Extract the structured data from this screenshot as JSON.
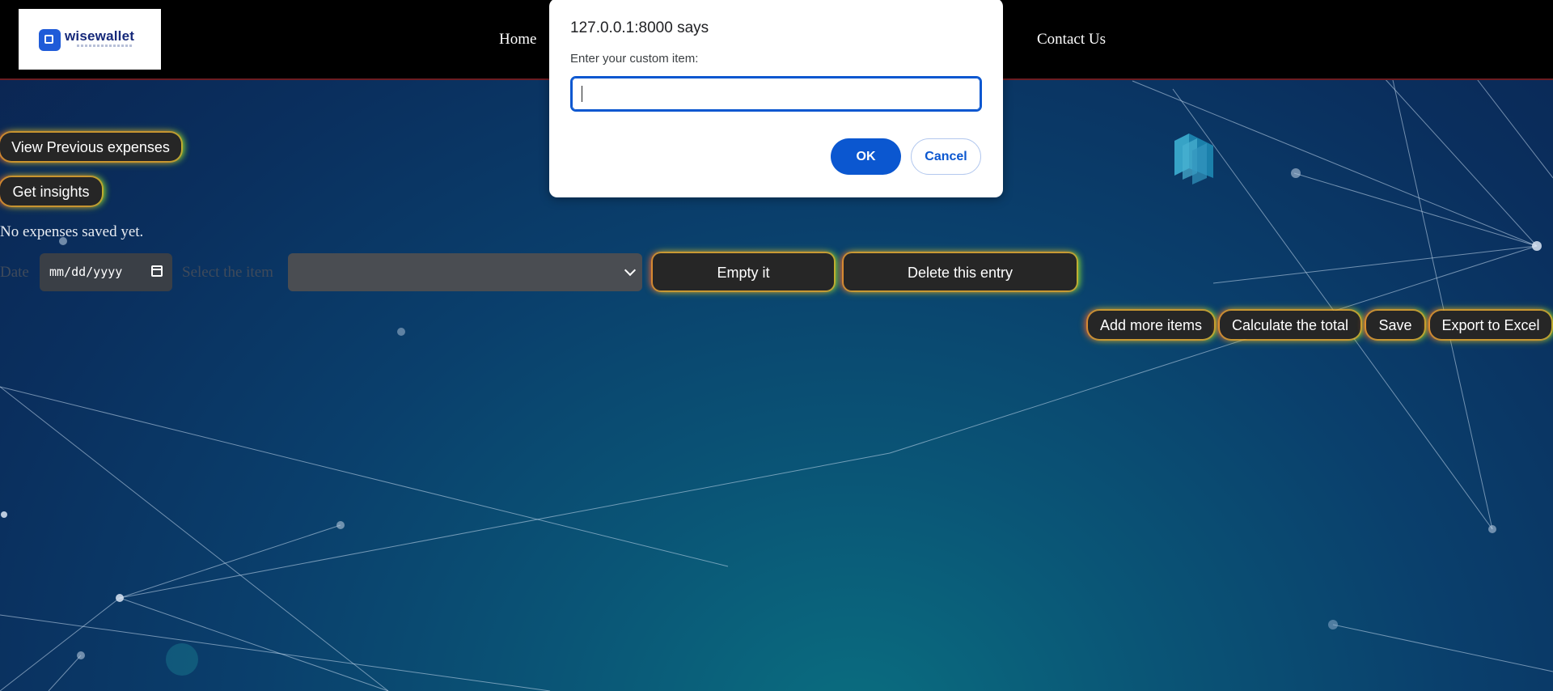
{
  "header": {
    "logo_text": "wisewallet",
    "nav": {
      "home": "Home",
      "contact": "Contact Us"
    }
  },
  "actions": {
    "view_previous": "View Previous expenses",
    "get_insights": "Get insights",
    "empty_message": "No expenses saved yet."
  },
  "entry_row": {
    "date_label": "Date",
    "date_placeholder": "mm/dd/yyyy",
    "item_label": "Select the item",
    "item_selected": "",
    "empty_button": "Empty it",
    "delete_button": "Delete this entry"
  },
  "toolbar": {
    "add_more": "Add more items",
    "calculate": "Calculate the total",
    "save": "Save",
    "export": "Export to Excel"
  },
  "dialog": {
    "title": "127.0.0.1:8000 says",
    "message": "Enter your custom item:",
    "input_value": "",
    "ok": "OK",
    "cancel": "Cancel"
  },
  "colors": {
    "accent_blue": "#0b57d0",
    "button_bg": "#262626",
    "header_bg": "#000000"
  }
}
